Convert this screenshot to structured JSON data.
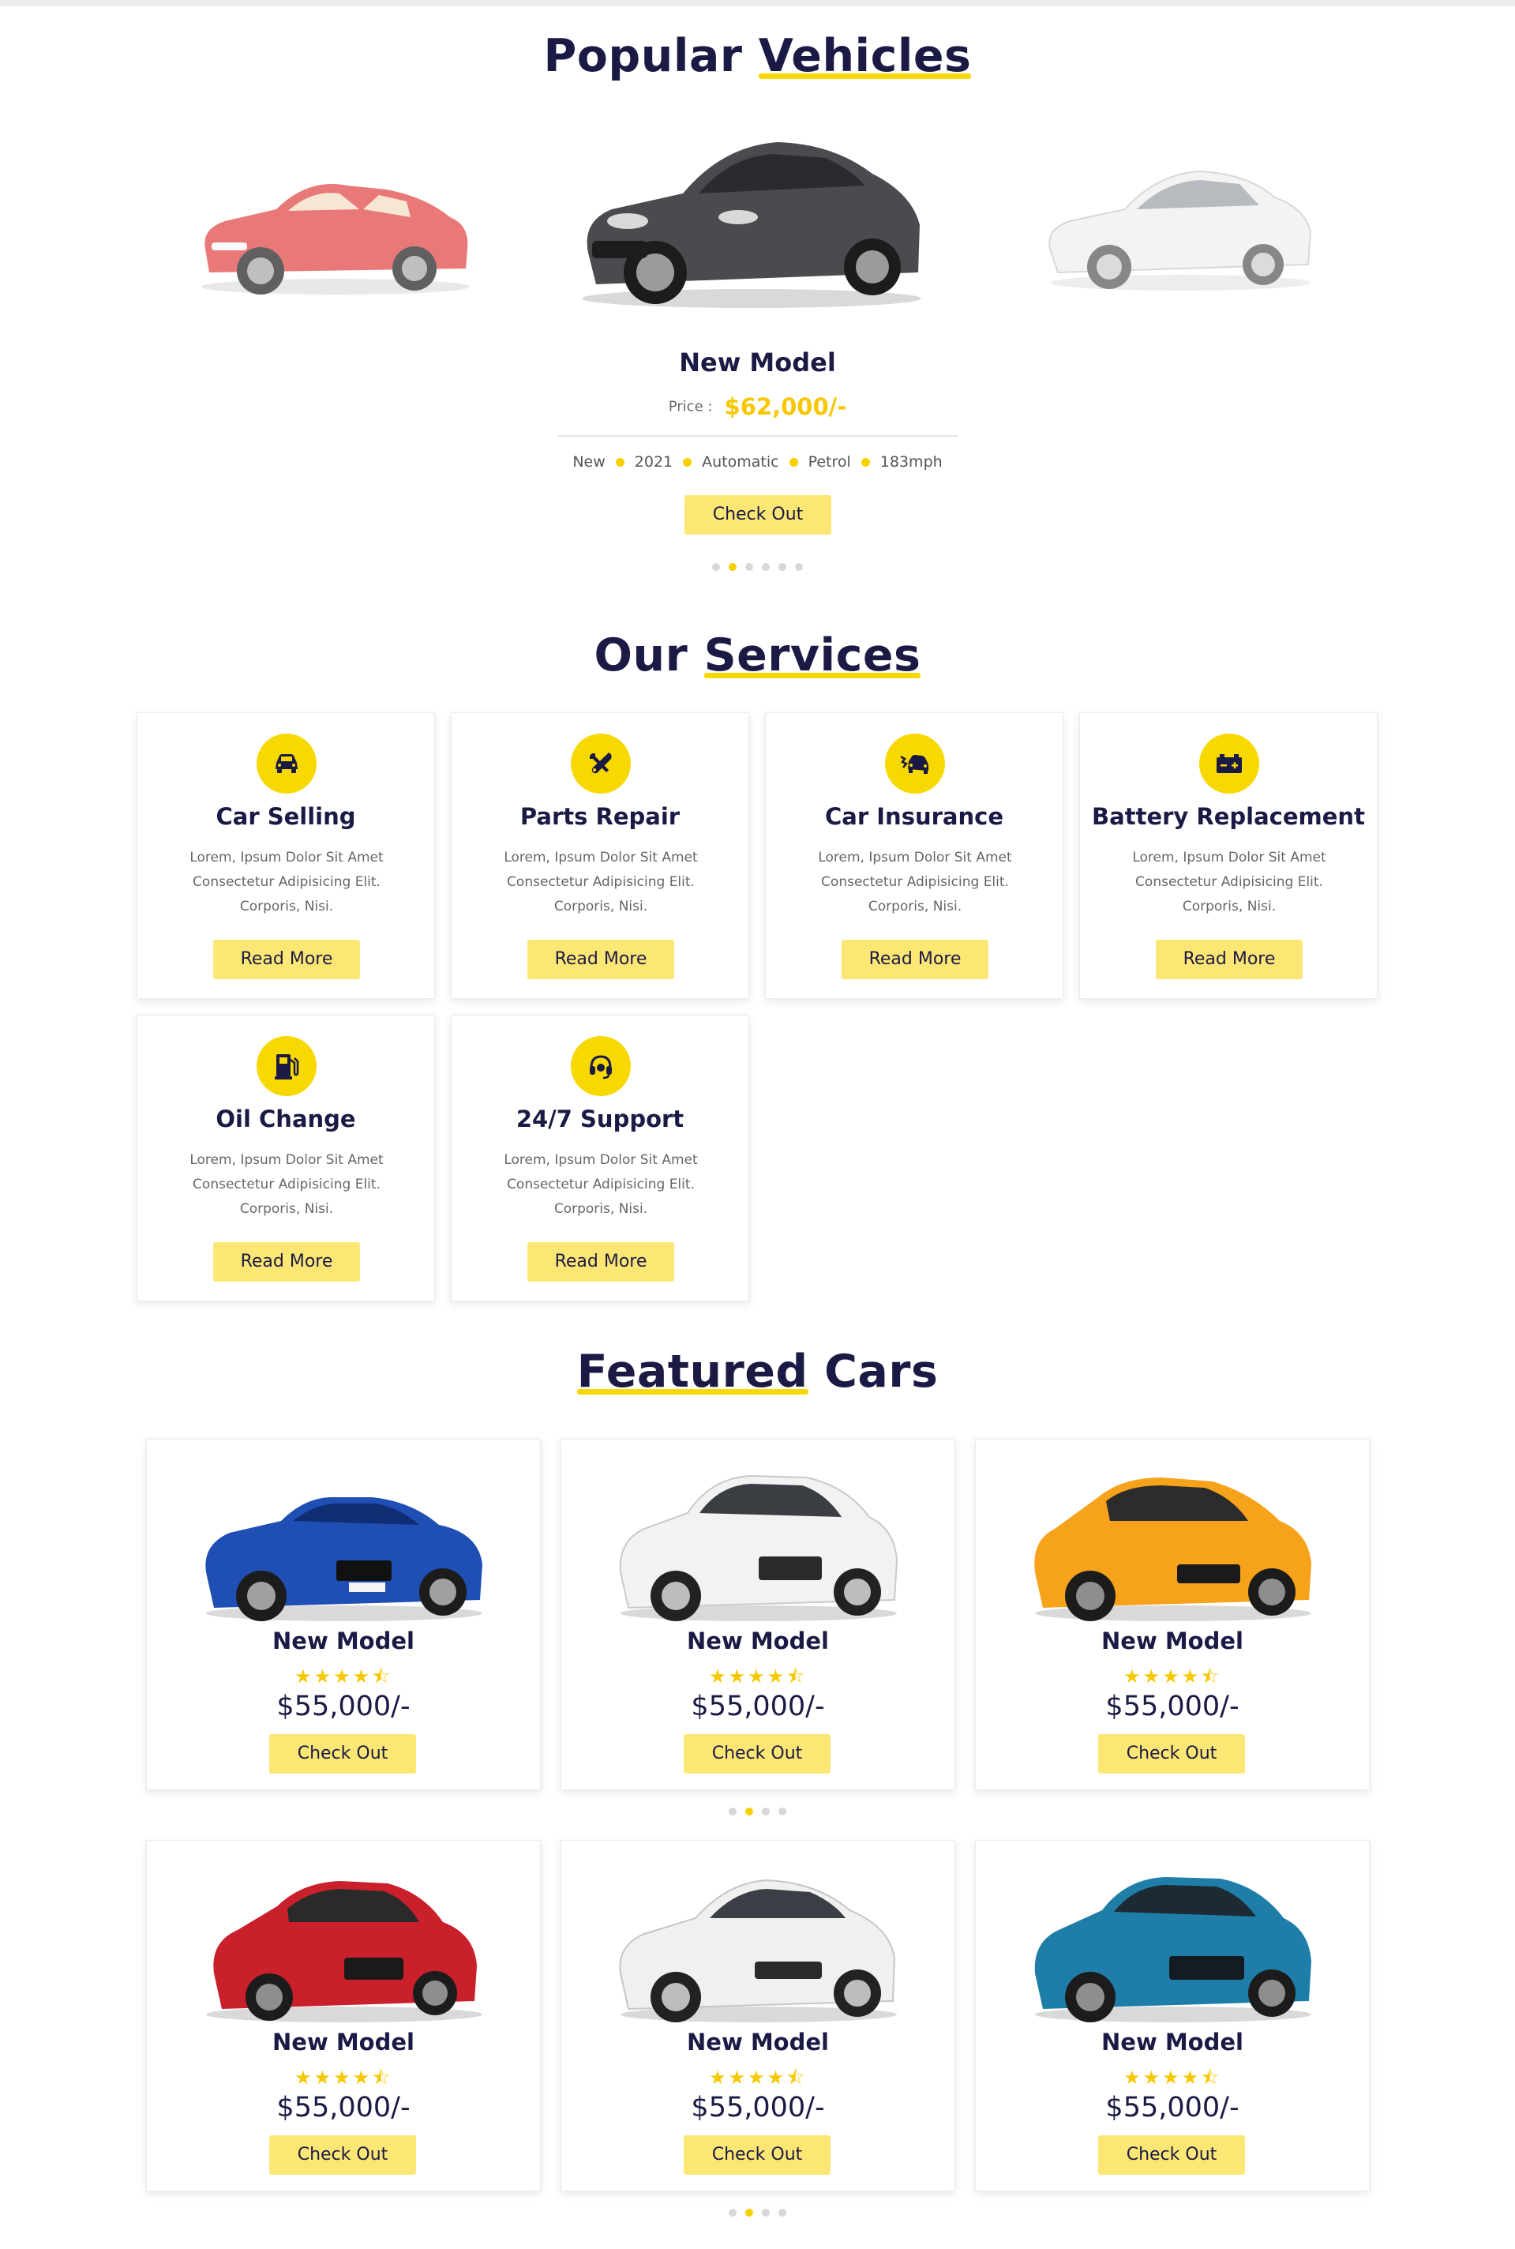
{
  "popular": {
    "title_part1": "Popular",
    "title_part2": "Vehicles",
    "model_name": "New Model",
    "price_label": "Price :",
    "price": "$62,000/-",
    "specs": [
      "New",
      "2021",
      "Automatic",
      "Petrol",
      "183mph"
    ],
    "cta": "Check Out",
    "slider_dots": 6,
    "active_dot": 2,
    "cars": [
      {
        "name": "red-convertible-car",
        "color": "#e24b4b",
        "faded": true
      },
      {
        "name": "dark-grey-sedan-car",
        "color": "#4a4b4f",
        "faded": false
      },
      {
        "name": "white-sedan-car",
        "color": "#eeeeee",
        "faded": true
      }
    ]
  },
  "services": {
    "title_part1": "Our",
    "title_part2": "Services",
    "items": [
      {
        "title": "Car Selling",
        "icon": "car-icon",
        "desc": [
          "Lorem, Ipsum Dolor Sit Amet",
          "Consectetur Adipisicing Elit.",
          "Corporis, Nisi."
        ],
        "cta": "Read More"
      },
      {
        "title": "Parts Repair",
        "icon": "tools-icon",
        "desc": [
          "Lorem, Ipsum Dolor Sit Amet",
          "Consectetur Adipisicing Elit.",
          "Corporis, Nisi."
        ],
        "cta": "Read More"
      },
      {
        "title": "Car Insurance",
        "icon": "car-crash-icon",
        "desc": [
          "Lorem, Ipsum Dolor Sit Amet",
          "Consectetur Adipisicing Elit.",
          "Corporis, Nisi."
        ],
        "cta": "Read More"
      },
      {
        "title": "Battery Replacement",
        "icon": "battery-icon",
        "desc": [
          "Lorem, Ipsum Dolor Sit Amet",
          "Consectetur Adipisicing Elit.",
          "Corporis, Nisi."
        ],
        "cta": "Read More"
      },
      {
        "title": "Oil Change",
        "icon": "gas-pump-icon",
        "desc": [
          "Lorem, Ipsum Dolor Sit Amet",
          "Consectetur Adipisicing Elit.",
          "Corporis, Nisi."
        ],
        "cta": "Read More"
      },
      {
        "title": "24/7 Support",
        "icon": "headset-icon",
        "desc": [
          "Lorem, Ipsum Dolor Sit Amet",
          "Consectetur Adipisicing Elit.",
          "Corporis, Nisi."
        ],
        "cta": "Read More"
      }
    ]
  },
  "featured": {
    "title_part1": "Featured",
    "title_part2": "Cars",
    "stars": "★★★★⯪",
    "rating": 4.5,
    "row1_dots": 4,
    "row1_active_dot": 2,
    "row2_dots": 4,
    "row2_active_dot": 2,
    "cars": [
      {
        "title": "New Model",
        "price": "$55,000/-",
        "cta": "Check Out",
        "color": "#1f4fb5",
        "car": "blue-convertible-car"
      },
      {
        "title": "New Model",
        "price": "$55,000/-",
        "cta": "Check Out",
        "color": "#f2f2f2",
        "car": "white-suv-car"
      },
      {
        "title": "New Model",
        "price": "$55,000/-",
        "cta": "Check Out",
        "color": "#f6a21a",
        "car": "orange-hatchback-car"
      },
      {
        "title": "New Model",
        "price": "$55,000/-",
        "cta": "Check Out",
        "color": "#c9202b",
        "car": "red-suv-car"
      },
      {
        "title": "New Model",
        "price": "$55,000/-",
        "cta": "Check Out",
        "color": "#f0f0f0",
        "car": "white-sedan-car"
      },
      {
        "title": "New Model",
        "price": "$55,000/-",
        "cta": "Check Out",
        "color": "#1f7ea8",
        "car": "teal-suv-car"
      }
    ]
  }
}
